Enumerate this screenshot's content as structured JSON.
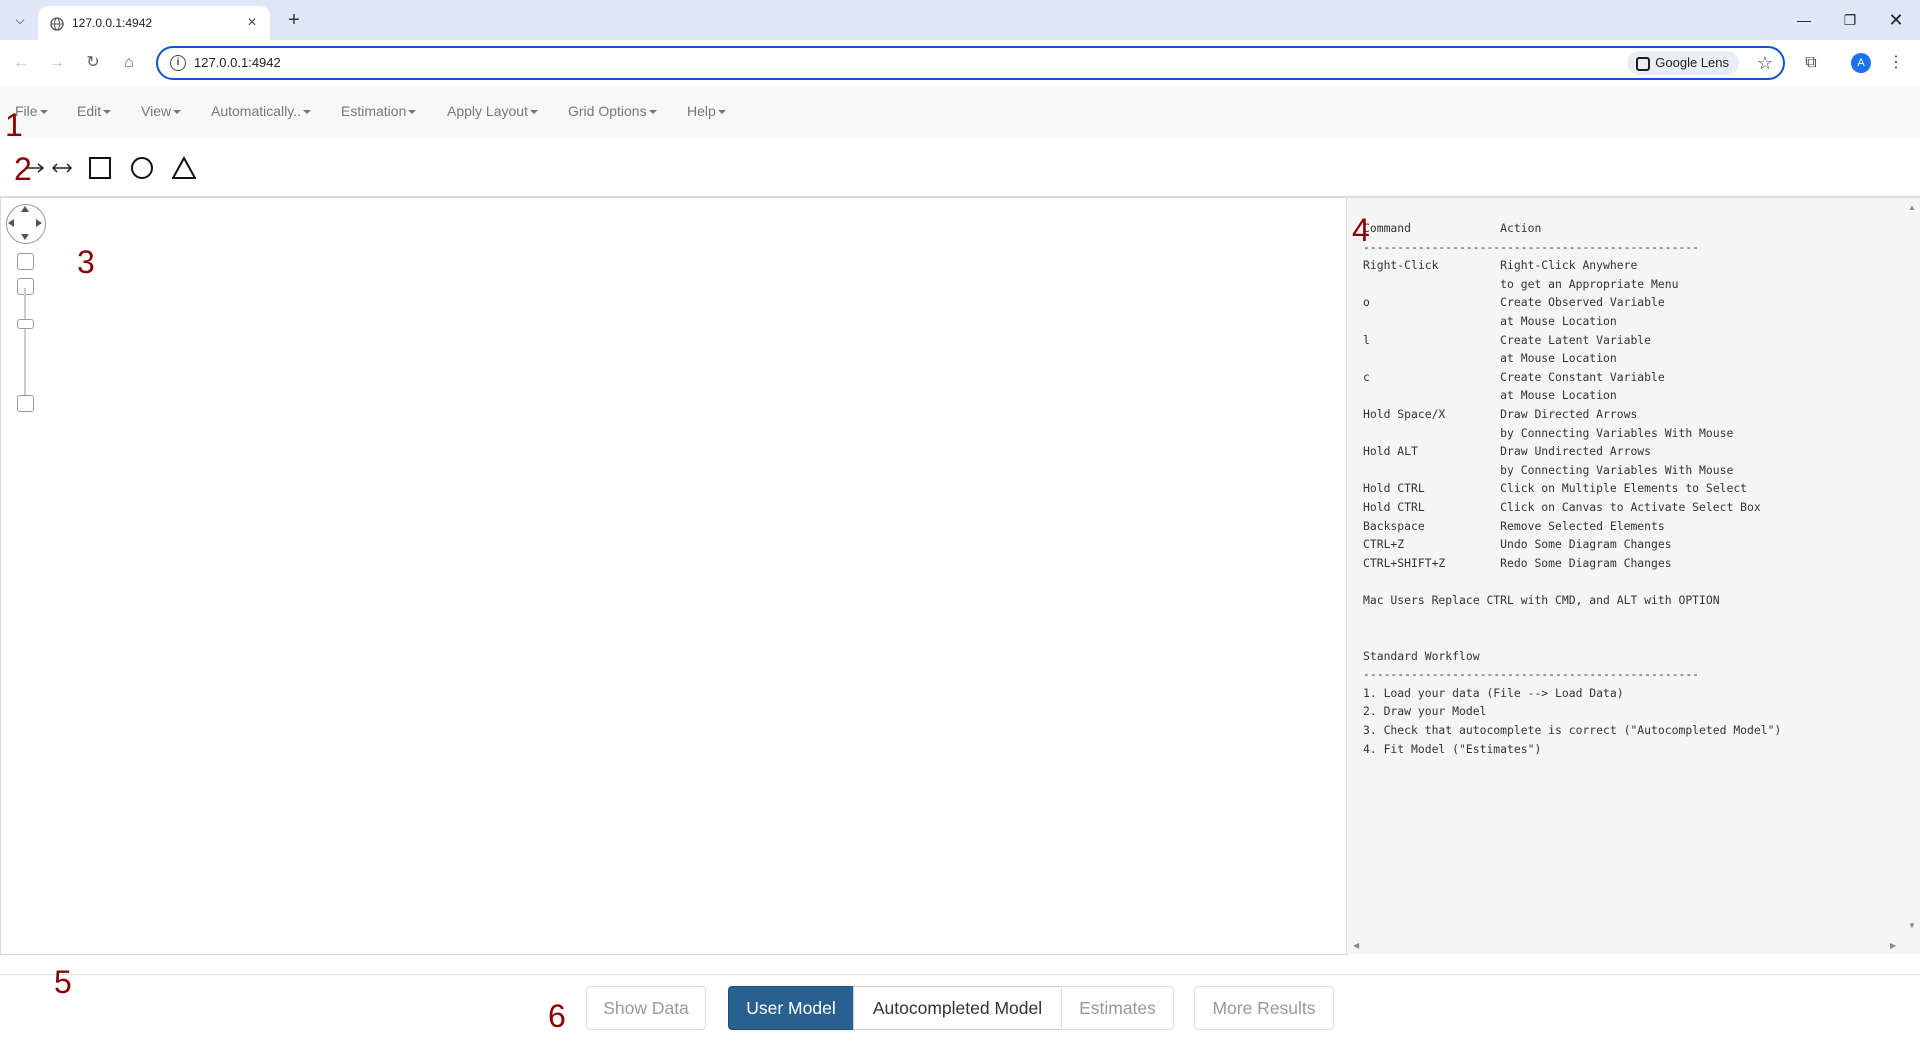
{
  "browser": {
    "tab_title": "127.0.0.1:4942",
    "url": "127.0.0.1:4942",
    "lens_label": "Google Lens",
    "avatar_letter": "A"
  },
  "menu": {
    "items": [
      "File",
      "Edit",
      "View",
      "Automatically..",
      "Estimation",
      "Apply Layout",
      "Grid Options",
      "Help"
    ]
  },
  "markers": [
    "1",
    "2",
    "3",
    "4",
    "5",
    "6"
  ],
  "help_text": "Command             Action\n-------------------------------------------------\nRight-Click         Right-Click Anywhere\n                    to get an Appropriate Menu\no                   Create Observed Variable\n                    at Mouse Location\nl                   Create Latent Variable\n                    at Mouse Location\nc                   Create Constant Variable\n                    at Mouse Location\nHold Space/X        Draw Directed Arrows\n                    by Connecting Variables With Mouse\nHold ALT            Draw Undirected Arrows\n                    by Connecting Variables With Mouse\nHold CTRL           Click on Multiple Elements to Select\nHold CTRL           Click on Canvas to Activate Select Box\nBackspace           Remove Selected Elements\nCTRL+Z              Undo Some Diagram Changes\nCTRL+SHIFT+Z        Redo Some Diagram Changes\n\nMac Users Replace CTRL with CMD, and ALT with OPTION\n\n\nStandard Workflow\n-------------------------------------------------\n1. Load your data (File --> Load Data)\n2. Draw your Model\n3. Check that autocomplete is correct (\"Autocompleted Model\")\n4. Fit Model (\"Estimates\")",
  "footer": {
    "show_data": "Show Data",
    "user_model": "User Model",
    "autocompleted_model": "Autocompleted Model",
    "estimates": "Estimates",
    "more_results": "More Results"
  },
  "colors": {
    "marker": "#8b0000",
    "active_button": "#286090",
    "omnibox_focus": "#0b57d0"
  }
}
